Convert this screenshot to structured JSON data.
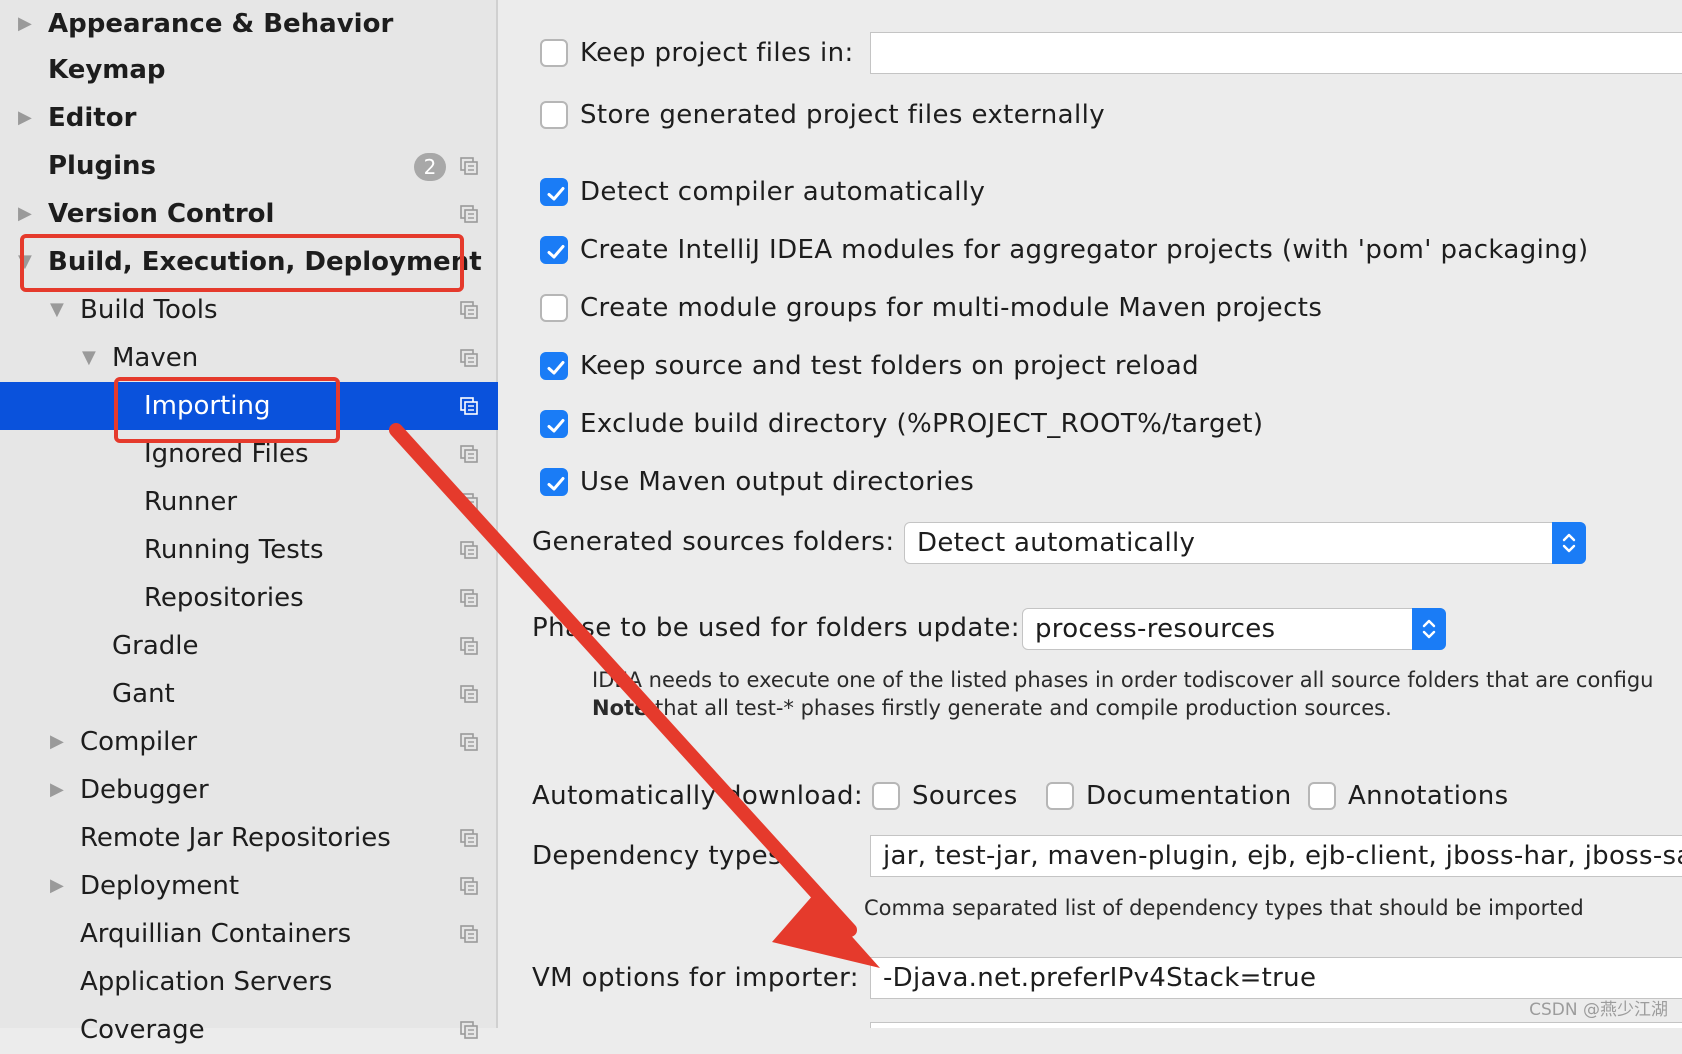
{
  "sidebar": {
    "items": [
      {
        "label": "Appearance & Behavior"
      },
      {
        "label": "Keymap"
      },
      {
        "label": "Editor"
      },
      {
        "label": "Plugins",
        "badge": "2"
      },
      {
        "label": "Version Control"
      },
      {
        "label": "Build, Execution, Deployment"
      },
      {
        "label": "Build Tools"
      },
      {
        "label": "Maven"
      },
      {
        "label": "Importing"
      },
      {
        "label": "Ignored Files"
      },
      {
        "label": "Runner"
      },
      {
        "label": "Running Tests"
      },
      {
        "label": "Repositories"
      },
      {
        "label": "Gradle"
      },
      {
        "label": "Gant"
      },
      {
        "label": "Compiler"
      },
      {
        "label": "Debugger"
      },
      {
        "label": "Remote Jar Repositories"
      },
      {
        "label": "Deployment"
      },
      {
        "label": "Arquillian Containers"
      },
      {
        "label": "Application Servers"
      },
      {
        "label": "Coverage"
      }
    ]
  },
  "settings": {
    "keep_project_files": {
      "label": "Keep project files in:",
      "checked": false,
      "value": ""
    },
    "store_externally": {
      "label": "Store generated project files externally",
      "checked": false
    },
    "detect_compiler": {
      "label": "Detect compiler automatically",
      "checked": true
    },
    "create_modules": {
      "label": "Create IntelliJ IDEA modules for aggregator projects (with 'pom' packaging)",
      "checked": true
    },
    "create_groups": {
      "label": "Create module groups for multi-module Maven projects",
      "checked": false
    },
    "keep_source_folders": {
      "label": "Keep source and test folders on project reload",
      "checked": true
    },
    "exclude_build_dir": {
      "label": "Exclude build directory (%PROJECT_ROOT%/target)",
      "checked": true
    },
    "use_maven_output": {
      "label": "Use Maven output directories",
      "checked": true
    },
    "generated_sources": {
      "label": "Generated sources folders:",
      "value": "Detect automatically"
    },
    "phase": {
      "label": "Phase to be used for folders update:",
      "value": "process-resources",
      "hint_line1": "IDEA needs to execute one of the listed phases in order todiscover all source folders that are configu",
      "hint_note_bold": "Note",
      "hint_line2": " that all test-* phases firstly generate and compile production sources."
    },
    "auto_download": {
      "label": "Automatically download:",
      "sources": "Sources",
      "documentation": "Documentation",
      "annotations": "Annotations"
    },
    "dependency_types": {
      "label": "Dependency types:",
      "value": "jar, test-jar, maven-plugin, ejb, ejb-client, jboss-har, jboss-sar,",
      "hint": "Comma separated list of dependency types that should be imported"
    },
    "vm_options": {
      "label": "VM options for importer:",
      "value": "-Djava.net.preferIPv4Stack=true"
    }
  },
  "watermark": "CSDN @燕少江湖",
  "colors": {
    "selection": "#0a52dc",
    "checkbox": "#1a7cf6",
    "annotation": "#e53a2c"
  }
}
